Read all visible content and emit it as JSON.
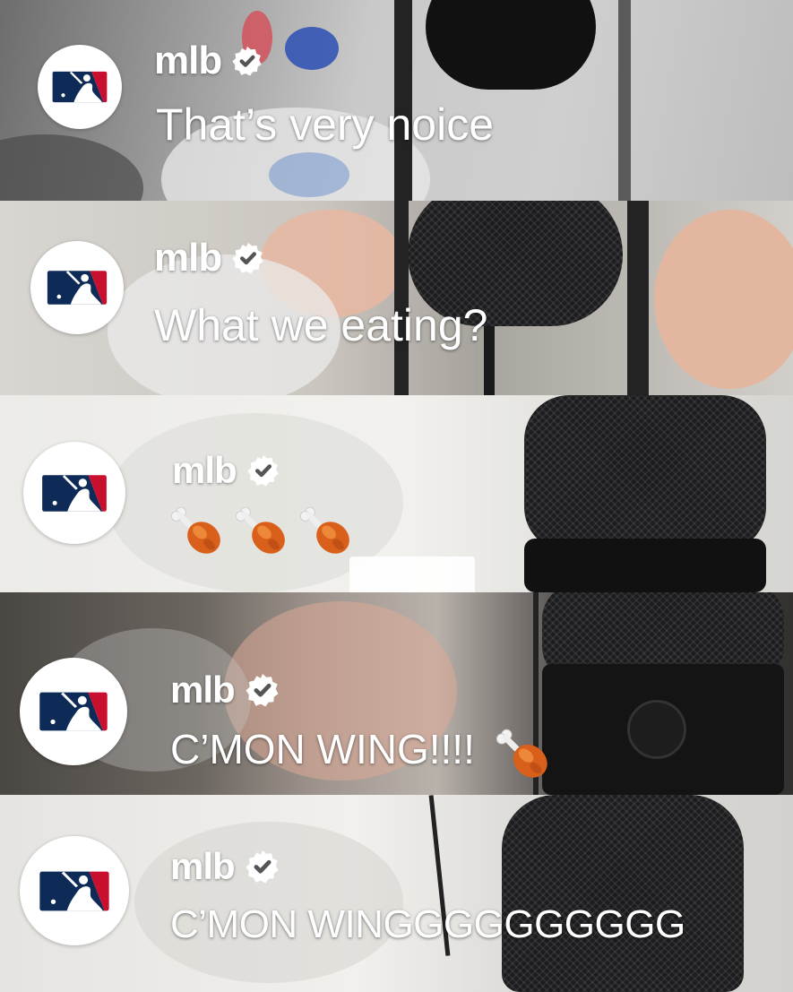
{
  "comments": [
    {
      "username": "mlb",
      "verified": true,
      "message": "That’s very noice",
      "avatar_icon": "mlb-logo-icon"
    },
    {
      "username": "mlb",
      "verified": true,
      "message": "What we eating?",
      "avatar_icon": "mlb-logo-icon"
    },
    {
      "username": "mlb",
      "verified": true,
      "message": "",
      "emoji": "poultry-leg-icon",
      "emoji_count": 3,
      "avatar_icon": "mlb-logo-icon"
    },
    {
      "username": "mlb",
      "verified": true,
      "message": "C’MON WING!!!!",
      "emoji": "poultry-leg-icon",
      "emoji_count": 1,
      "avatar_icon": "mlb-logo-icon"
    },
    {
      "username": "mlb",
      "verified": true,
      "message": "C’MON WINGGGGGGGGGG",
      "avatar_icon": "mlb-logo-icon"
    }
  ],
  "colors": {
    "mlb_navy": "#0d2b56",
    "mlb_red": "#c8102e",
    "text": "#ffffff",
    "badge_bg": "#ffffff",
    "badge_check": "#555555"
  }
}
